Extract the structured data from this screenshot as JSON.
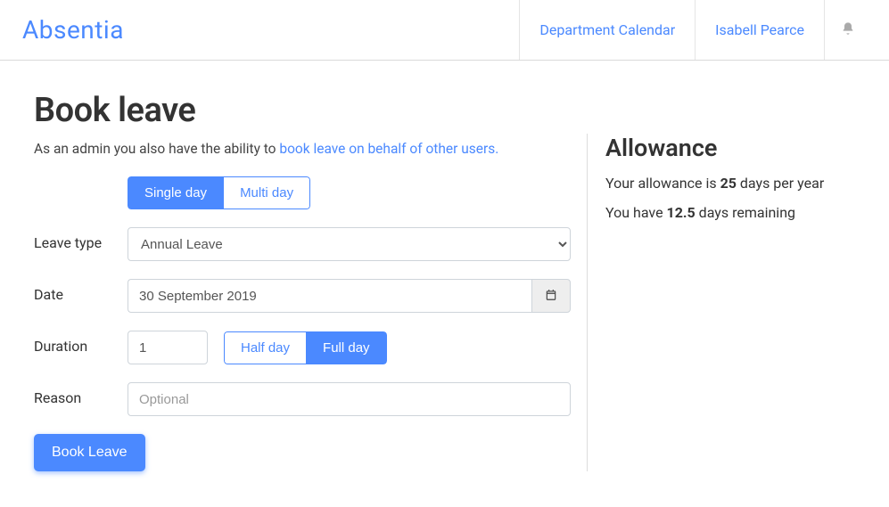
{
  "header": {
    "brand": "Absentia",
    "nav": {
      "calendar": "Department Calendar",
      "user": "Isabell Pearce"
    }
  },
  "page": {
    "title": "Book leave",
    "subtitle_prefix": "As an admin you also have the ability to ",
    "subtitle_link": "book leave on behalf of other users.",
    "tabs": {
      "single": "Single day",
      "multi": "Multi day"
    },
    "labels": {
      "leave_type": "Leave type",
      "date": "Date",
      "duration": "Duration",
      "reason": "Reason"
    },
    "leave_type_value": "Annual Leave",
    "date_value": "30 September 2019",
    "duration_value": "1",
    "duration_buttons": {
      "half": "Half day",
      "full": "Full day"
    },
    "reason_placeholder": "Optional",
    "submit": "Book Leave"
  },
  "allowance": {
    "title": "Allowance",
    "line1_prefix": "Your allowance is ",
    "line1_value": "25",
    "line1_suffix": " days per year",
    "line2_prefix": "You have ",
    "line2_value": "12.5",
    "line2_suffix": " days remaining"
  }
}
